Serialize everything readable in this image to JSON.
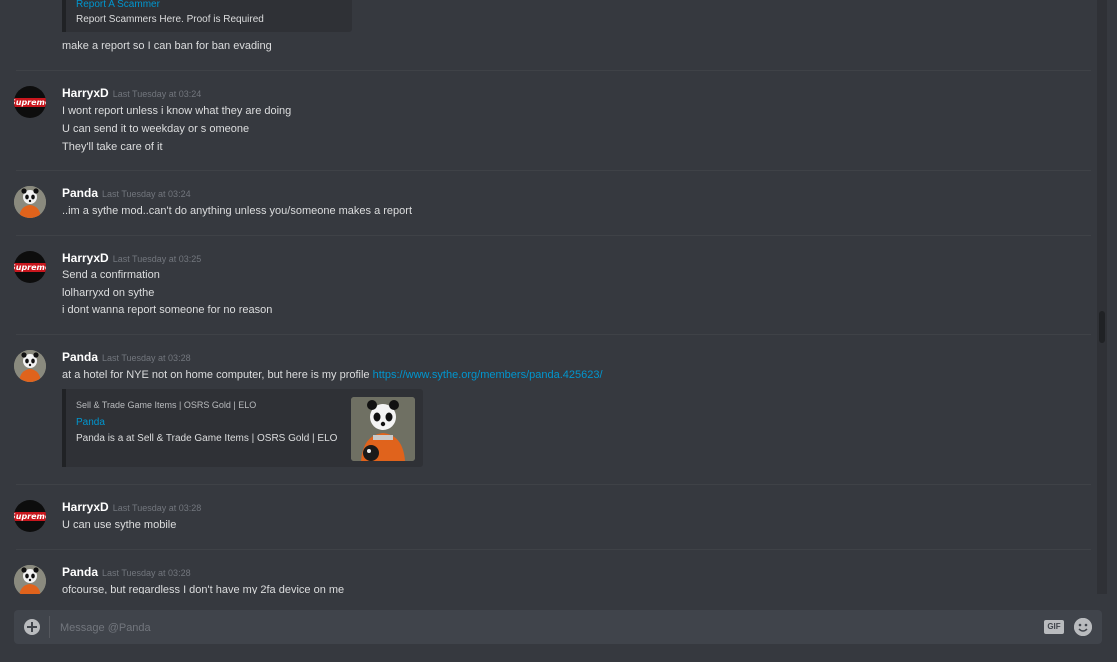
{
  "composer": {
    "placeholder": "Message @Panda",
    "gif_label": "GIF"
  },
  "top_embed": {
    "title": "Report A Scammer",
    "description": "Report Scammers Here. Proof is Required"
  },
  "messages": [
    {
      "lines": [
        "make a report so I can ban for ban evading"
      ]
    },
    {
      "author": "HarryxD",
      "timestamp": "Last Tuesday at 03:24",
      "lines": [
        "I wont report unless i know what they are doing",
        "U can send it to weekday or s omeone",
        "They'll take care of it"
      ]
    },
    {
      "author": "Panda",
      "timestamp": "Last Tuesday at 03:24",
      "lines": [
        "..im a sythe mod..can't do anything unless you/someone makes a report"
      ]
    },
    {
      "author": "HarryxD",
      "timestamp": "Last Tuesday at 03:25",
      "lines": [
        "Send a confirmation",
        "lolharryxd on sythe",
        "i dont wanna report someone for no reason"
      ]
    },
    {
      "author": "Panda",
      "timestamp": "Last Tuesday at 03:28",
      "text": "at a hotel for NYE not on home computer, but here is my profile",
      "link": "https://www.sythe.org/members/panda.425623/",
      "embed": {
        "provider": "Sell & Trade Game Items | OSRS Gold | ELO",
        "title": "Panda",
        "description": "Panda is a at Sell & Trade Game Items | OSRS Gold | ELO"
      }
    },
    {
      "author": "HarryxD",
      "timestamp": "Last Tuesday at 03:28",
      "lines": [
        "U can use sythe mobile"
      ]
    },
    {
      "author": "Panda",
      "timestamp": "Last Tuesday at 03:28",
      "lines": [
        "ofcourse, but regardless I don't have my 2fa device on me"
      ]
    }
  ]
}
